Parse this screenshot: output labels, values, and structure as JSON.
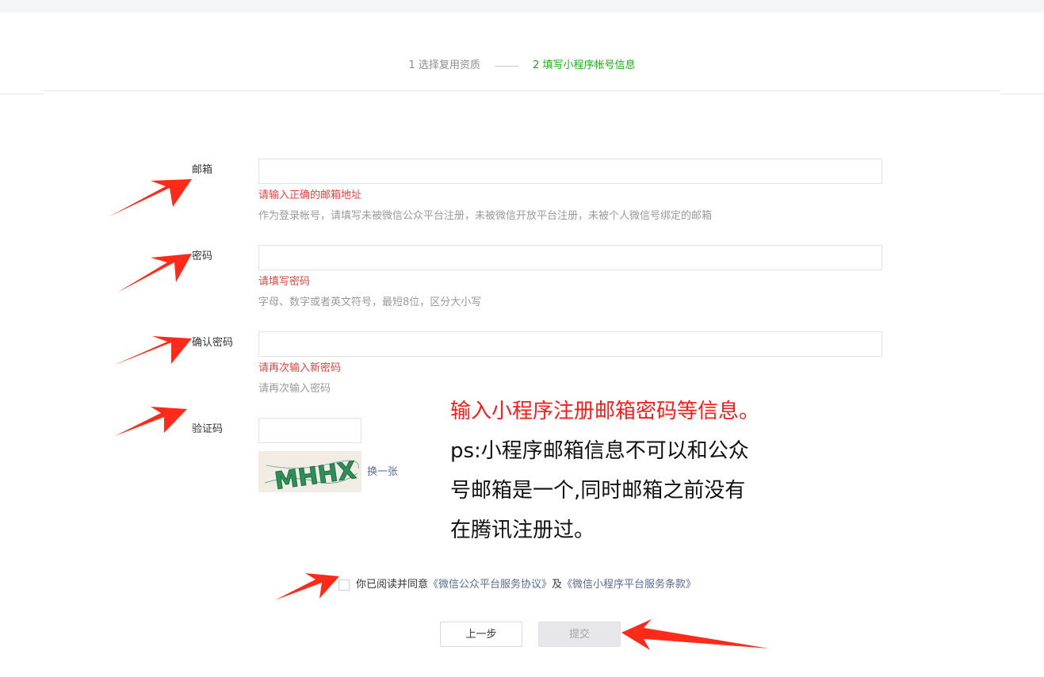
{
  "steps": {
    "step1": "1 选择复用资质",
    "step2": "2 填写小程序帐号信息"
  },
  "form": {
    "email": {
      "label": "邮箱",
      "error": "请输入正确的邮箱地址",
      "hint": "作为登录帐号，请填写未被微信公众平台注册，未被微信开放平台注册，未被个人微信号绑定的邮箱"
    },
    "password": {
      "label": "密码",
      "error": "请填写密码",
      "hint": "字母、数字或者英文符号，最短8位，区分大小写"
    },
    "confirm_password": {
      "label": "确认密码",
      "error": "请再次输入新密码",
      "hint": "请再次输入密码"
    },
    "captcha": {
      "label": "验证码",
      "image_text": "MHHX",
      "change_link": "换一张"
    }
  },
  "annotation": {
    "line1": "输入小程序注册邮箱密码等信息。",
    "line2": "ps:小程序邮箱信息不可以和公众",
    "line3": "号邮箱是一个,同时邮箱之前没有",
    "line4": "在腾讯注册过。"
  },
  "agreement": {
    "prefix": "你已阅读并同意",
    "link1": "《微信公众平台服务协议》",
    "middle": "及",
    "link2": "《微信小程序平台服务条款》",
    "checked": false
  },
  "buttons": {
    "prev": "上一步",
    "submit": "提交"
  },
  "colors": {
    "active_step": "#1aad19",
    "error": "#e64340",
    "link": "#576b95",
    "annotation_arrow": "#ff2a1a"
  }
}
